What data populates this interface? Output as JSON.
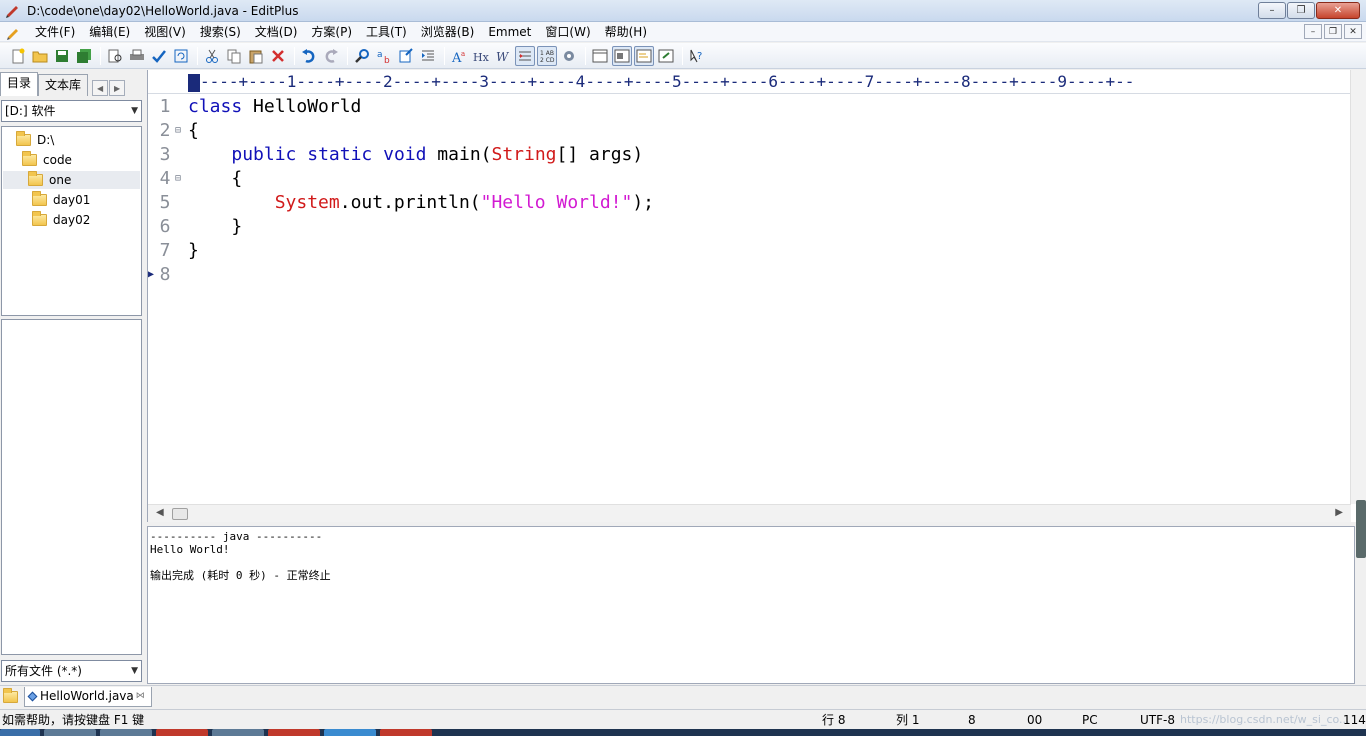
{
  "window": {
    "title": "D:\\code\\one\\day02\\HelloWorld.java - EditPlus",
    "controls": {
      "minimize": "–",
      "restore": "❐",
      "close": "✕"
    }
  },
  "menubar": {
    "items": [
      "文件(F)",
      "编辑(E)",
      "视图(V)",
      "搜索(S)",
      "文档(D)",
      "方案(P)",
      "工具(T)",
      "浏览器(B)",
      "Emmet",
      "窗口(W)",
      "帮助(H)"
    ],
    "mdi": {
      "minimize": "–",
      "restore": "❐",
      "close": "✕"
    }
  },
  "toolbar": {
    "icons": [
      "new-file-icon",
      "open-icon",
      "save-icon",
      "save-all-icon",
      "print-preview-icon",
      "print-icon",
      "spell-check-icon",
      "refresh-icon",
      "cut-icon",
      "copy-icon",
      "paste-icon",
      "delete-icon",
      "undo-icon",
      "redo-icon",
      "find-icon",
      "replace-icon",
      "goto-icon",
      "indent-icon",
      "font-icon",
      "hex-icon",
      "word-wrap-icon",
      "ruler-icon",
      "line-number-icon",
      "settings-icon",
      "browser-icon",
      "output-window-icon",
      "cliptext-icon",
      "directory-icon",
      "help-icon"
    ]
  },
  "sidebar": {
    "tabs": [
      "目录",
      "文本库"
    ],
    "drive": "[D:] 软件",
    "tree": [
      {
        "label": "D:\\",
        "indent": 0
      },
      {
        "label": "code",
        "indent": 1
      },
      {
        "label": "one",
        "indent": 2,
        "selected": true
      },
      {
        "label": "day01",
        "indent": 3
      },
      {
        "label": "day02",
        "indent": 3
      }
    ],
    "filter": "所有文件 (*.*)"
  },
  "ruler": "----+----1----+----2----+----3----+----4----+----5----+----6----+----7----+----8----+----9----+--",
  "editor": {
    "lines": [
      {
        "num": "1",
        "fold": ""
      },
      {
        "num": "2",
        "fold": "⊟"
      },
      {
        "num": "3",
        "fold": ""
      },
      {
        "num": "4",
        "fold": "⊟"
      },
      {
        "num": "5",
        "fold": ""
      },
      {
        "num": "6",
        "fold": ""
      },
      {
        "num": "7",
        "fold": ""
      },
      {
        "num": "8",
        "fold": "",
        "current": true
      }
    ],
    "code": {
      "l1": [
        "class",
        " HelloWorld"
      ],
      "l2": "{",
      "l3": [
        "    ",
        "public",
        " ",
        "static",
        " ",
        "void",
        " main(",
        "String",
        "[] args)"
      ],
      "l4": "    {",
      "l5": [
        "        ",
        "System",
        ".out.println(",
        "\"Hello World!\"",
        ");"
      ],
      "l6": "    }",
      "l7": "}"
    }
  },
  "output": {
    "lines": [
      "---------- java ----------",
      "Hello World!",
      "",
      "输出完成 (耗时 0 秒) - 正常终止"
    ]
  },
  "doc_tabs": [
    {
      "label": "HelloWorld.java"
    }
  ],
  "statusbar": {
    "help": "如需帮助，请按键盘 F1 键",
    "line": "行 8",
    "col": "列 1",
    "total": "8",
    "code": "00",
    "eol": "PC",
    "encoding": "UTF-8",
    "watermark": "https://blog.csdn.net/w_si_co...",
    "size": "114"
  },
  "colors": {
    "keyword": "#1111b8",
    "type": "#d11a1a",
    "string": "#d21ad2"
  }
}
